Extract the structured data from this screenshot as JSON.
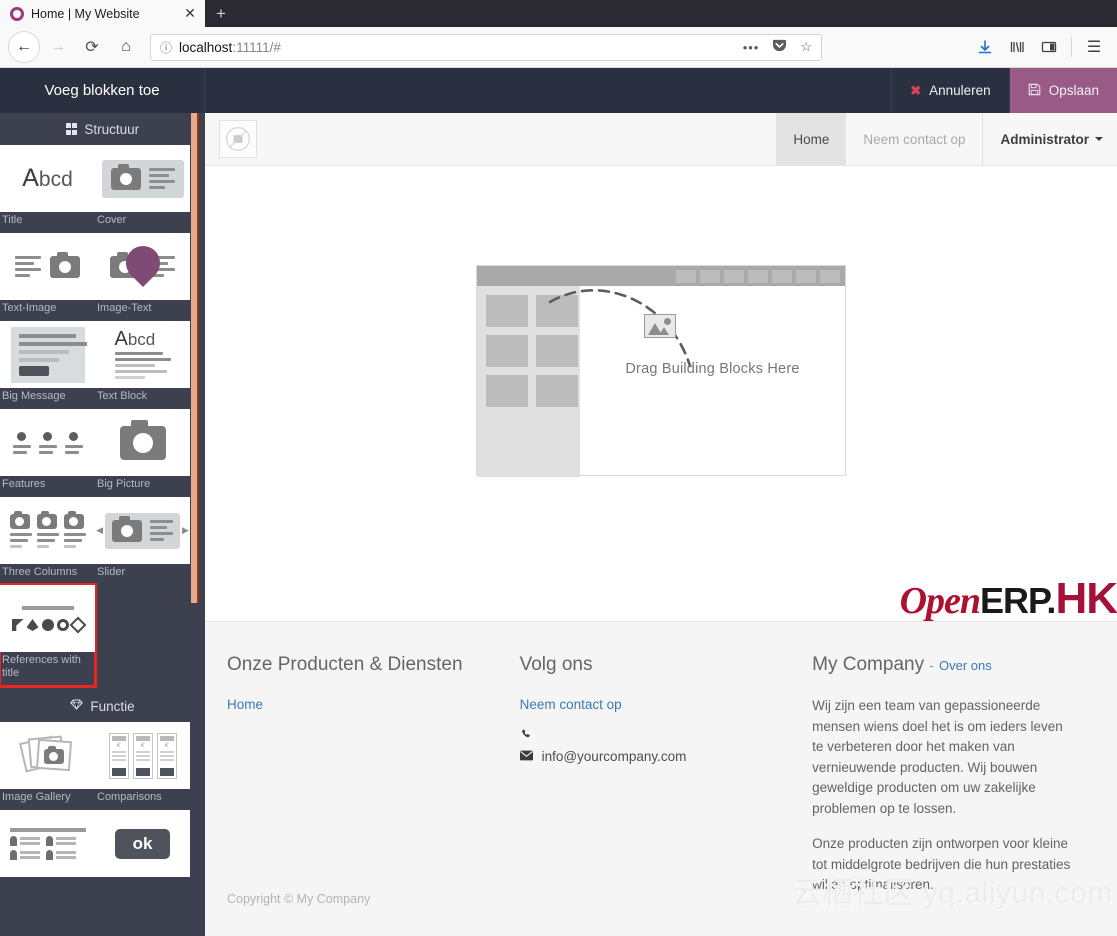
{
  "browser": {
    "tab_title": "Home | My Website",
    "favicon": "circle-favicon",
    "close_label": "✕",
    "newtab_label": "+",
    "back_icon": "←",
    "forward_icon": "→",
    "reload_icon": "⟳",
    "home_icon": "⌂",
    "url_info_icon": "ⓘ",
    "url_host": "localhost",
    "url_rest": ":11111/#",
    "url_dots": "•••",
    "pocket_icon": "pocket-icon",
    "bookmark_icon": "☆",
    "download_icon": "↓",
    "library_icon": "library-icon",
    "sidebar_icon": "sidebar-icon",
    "menu_icon": "☰"
  },
  "editor_bar": {
    "title": "Voeg blokken toe",
    "cancel_label": "Annuleren",
    "cancel_icon": "✖",
    "save_label": "Opslaan",
    "save_icon": "💾",
    "bar_bg": "#2b3040",
    "save_bg": "#9a5a86"
  },
  "sidebar": {
    "sections": [
      {
        "name": "Structuur",
        "icon": "grid-icon",
        "blocks": [
          {
            "label": "Title",
            "thumb": "title-thumb"
          },
          {
            "label": "Cover",
            "thumb": "cover-thumb"
          },
          {
            "label": "Text-Image",
            "thumb": "text-image-thumb"
          },
          {
            "label": "Image-Text",
            "thumb": "image-text-thumb"
          },
          {
            "label": "Big Message",
            "thumb": "big-message-thumb"
          },
          {
            "label": "Text Block",
            "thumb": "text-block-thumb"
          },
          {
            "label": "Features",
            "thumb": "features-thumb"
          },
          {
            "label": "Big Picture",
            "thumb": "big-picture-thumb"
          },
          {
            "label": "Three Columns",
            "thumb": "three-columns-thumb"
          },
          {
            "label": "Slider",
            "thumb": "slider-thumb"
          },
          {
            "label": "References with title",
            "thumb": "references-thumb",
            "selected": true
          }
        ]
      },
      {
        "name": "Functie",
        "icon": "diamond-icon",
        "blocks": [
          {
            "label": "Image Gallery",
            "thumb": "image-gallery-thumb"
          },
          {
            "label": "Comparisons",
            "thumb": "comparisons-thumb"
          },
          {
            "label": "",
            "thumb": "people-thumb"
          },
          {
            "label": "",
            "thumb": "ok-button-thumb"
          }
        ]
      }
    ],
    "selection_color": "#e8251f",
    "scroll_thumb_color": "#e8a98e"
  },
  "site": {
    "logo": "broken-image-placeholder",
    "nav": [
      {
        "label": "Home",
        "active": true
      },
      {
        "label": "Neem contact op",
        "active": false
      }
    ],
    "user_menu": "Administrator",
    "dropzone_text": "Drag Building Blocks Here",
    "brand_logo": {
      "open": "Open",
      "erp": "ERP.",
      "hk": "HK"
    }
  },
  "footer": {
    "col1": {
      "heading": "Onze Producten & Diensten",
      "links": [
        "Home"
      ]
    },
    "col2": {
      "heading": "Volg ons",
      "links": [
        "Neem contact op"
      ],
      "phone_icon": "☎",
      "phone": "",
      "mail_icon": "✉",
      "email": "info@yourcompany.com"
    },
    "col3": {
      "heading": "My Company",
      "dash": "-",
      "sub_link": "Over ons",
      "paragraphs": [
        "Wij zijn een team van gepassioneerde mensen wiens doel het is om ieders leven te verbeteren door het maken van vernieuwende producten. Wij bouwen geweldige producten om uw zakelijke problemen op te lossen.",
        "Onze producten zijn ontworpen voor kleine tot middelgrote bedrijven die hun prestaties willen optimaliseren."
      ]
    },
    "copyright": "Copyright © My Company",
    "watermark": "云栖社区 yq.aliyun.com"
  }
}
